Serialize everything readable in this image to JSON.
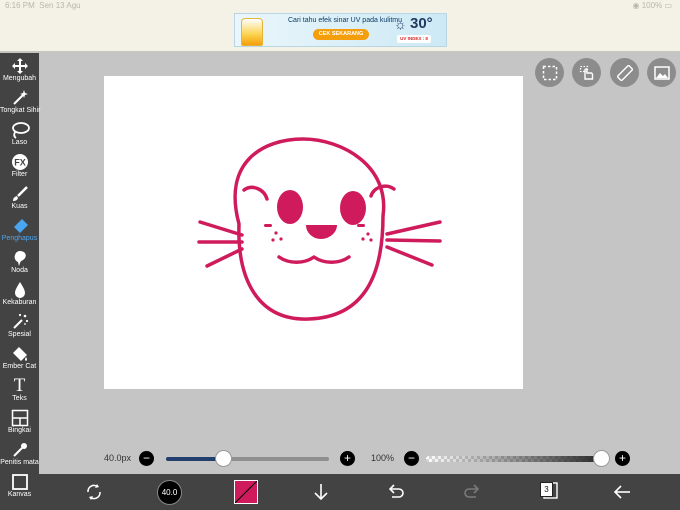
{
  "status_bar": {
    "time": "6:16 PM",
    "date": "Sen 13 Agu",
    "battery": "100%"
  },
  "ad": {
    "headline": "Cari tahu efek sinar UV pada kulitmu",
    "cta": "CEK SEKARANG",
    "temperature": "30°",
    "uv_badge": "UV INDEX : 8"
  },
  "tools": [
    {
      "name": "tool-move",
      "label": "Mengubah",
      "icon": "move-icon"
    },
    {
      "name": "tool-magic-wand",
      "label": "Tongkat Sihir",
      "icon": "magic-wand-icon"
    },
    {
      "name": "tool-lasso",
      "label": "Laso",
      "icon": "lasso-icon"
    },
    {
      "name": "tool-filter",
      "label": "Filter",
      "icon": "fx-icon"
    },
    {
      "name": "tool-brush",
      "label": "Kuas",
      "icon": "brush-icon"
    },
    {
      "name": "tool-eraser",
      "label": "Penghapus",
      "icon": "eraser-icon",
      "active": true
    },
    {
      "name": "tool-smudge",
      "label": "Noda",
      "icon": "smudge-icon"
    },
    {
      "name": "tool-blur",
      "label": "Kekaburan",
      "icon": "blur-drop-icon"
    },
    {
      "name": "tool-special",
      "label": "Spesial",
      "icon": "sparkle-wand-icon"
    },
    {
      "name": "tool-bucket",
      "label": "Ember Cat",
      "icon": "paint-bucket-icon"
    },
    {
      "name": "tool-text",
      "label": "Teks",
      "icon": "text-t-icon"
    },
    {
      "name": "tool-frame",
      "label": "Bingkai",
      "icon": "frame-icon"
    },
    {
      "name": "tool-eyedropper",
      "label": "Penitis mata",
      "icon": "eyedropper-icon"
    },
    {
      "name": "tool-canvas",
      "label": "Kanvas",
      "icon": "canvas-icon"
    }
  ],
  "brush": {
    "size_label": "40.0px",
    "size_fraction": 0.35,
    "preview_label": "40.0",
    "opacity_label": "100%",
    "opacity_fraction": 1.0
  },
  "colors": {
    "brush_color": "#cf1b5c",
    "active_accent": "#4aa6f0",
    "toolbar_bg": "#434343"
  },
  "layers": {
    "count": "3"
  }
}
